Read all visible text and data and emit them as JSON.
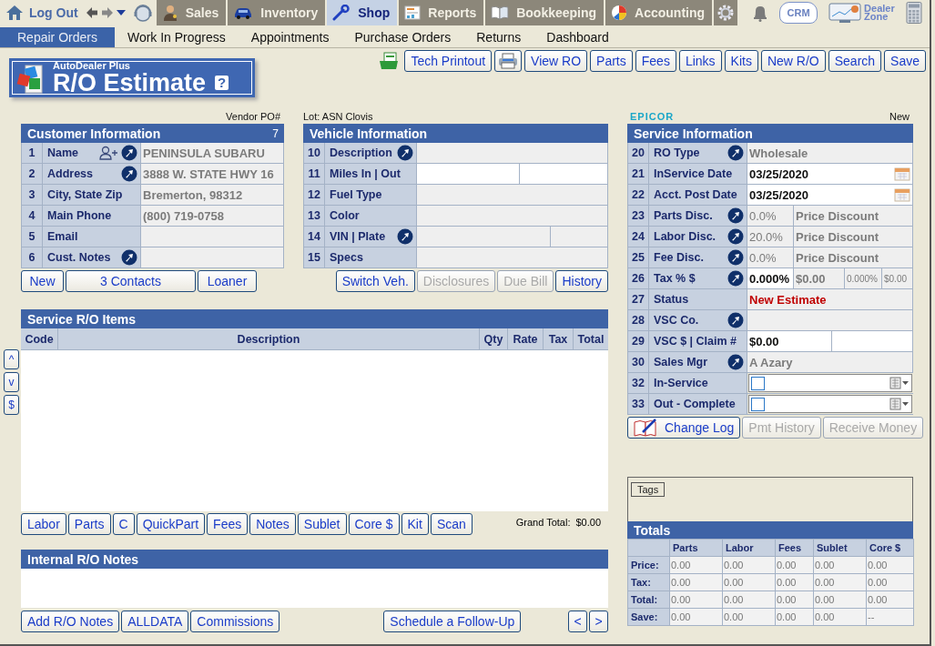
{
  "top_bar": {
    "logout": "Log Out",
    "modules": [
      {
        "label": "Sales",
        "selected": false
      },
      {
        "label": "Inventory",
        "selected": false
      },
      {
        "label": "Shop",
        "selected": true
      },
      {
        "label": "Reports",
        "selected": false
      },
      {
        "label": "Bookkeeping",
        "selected": false
      },
      {
        "label": "Accounting",
        "selected": false
      }
    ],
    "crm": "CRM",
    "dealer_zone": "Dealer Zone"
  },
  "menu": [
    {
      "label": "Repair Orders",
      "selected": true
    },
    {
      "label": "Work In Progress",
      "selected": false
    },
    {
      "label": "Appointments",
      "selected": false
    },
    {
      "label": "Purchase Orders",
      "selected": false
    },
    {
      "label": "Returns",
      "selected": false
    },
    {
      "label": "Dashboard",
      "selected": false
    }
  ],
  "logo": {
    "brand": "AutoDealer Plus",
    "title": "R/O Estimate",
    "help": "?"
  },
  "toolbar": [
    {
      "kind": "export"
    },
    {
      "kind": "text",
      "label": "Tech Printout"
    },
    {
      "kind": "print"
    },
    {
      "kind": "text",
      "label": "View RO"
    },
    {
      "kind": "text",
      "label": "Parts"
    },
    {
      "kind": "text",
      "label": "Fees"
    },
    {
      "kind": "text",
      "label": "Links"
    },
    {
      "kind": "text",
      "label": "Kits"
    },
    {
      "kind": "text",
      "label": "New R/O"
    },
    {
      "kind": "text",
      "label": "Search"
    },
    {
      "kind": "text",
      "label": "Save"
    }
  ],
  "customer": {
    "note": "Vendor PO#",
    "title": "Customer Information",
    "count": "7",
    "rows": [
      {
        "number": "1",
        "label": "Name",
        "add_contact": true,
        "lookup": true,
        "kind": "text",
        "cells": [
          {
            "value": "PENINSULA SUBARU",
            "editable": false
          }
        ]
      },
      {
        "number": "2",
        "label": "Address",
        "add_contact": false,
        "lookup": true,
        "kind": "text",
        "cells": [
          {
            "value": "3888 W. STATE HWY 16",
            "editable": false
          }
        ]
      },
      {
        "number": "3",
        "label": "City, State Zip",
        "add_contact": false,
        "lookup": false,
        "kind": "text",
        "cells": [
          {
            "value": "Bremerton,  98312",
            "editable": false
          }
        ]
      },
      {
        "number": "4",
        "label": "Main Phone",
        "add_contact": false,
        "lookup": false,
        "kind": "text",
        "cells": [
          {
            "value": "(800) 719-0758",
            "editable": false
          }
        ]
      },
      {
        "number": "5",
        "label": "Email",
        "add_contact": false,
        "lookup": false,
        "kind": "text",
        "cells": [
          {
            "editable": false
          }
        ]
      },
      {
        "number": "6",
        "label": "Cust. Notes",
        "add_contact": false,
        "lookup": true,
        "kind": "text",
        "cells": [
          {
            "editable": false
          }
        ]
      }
    ],
    "buttons": [
      {
        "label": "New",
        "disabled": false
      },
      {
        "label": "3 Contacts",
        "disabled": false
      },
      {
        "label": "Loaner",
        "disabled": false
      }
    ]
  },
  "vehicle": {
    "note": "Lot: ASN Clovis",
    "title": "Vehicle Information",
    "rows": [
      {
        "number": "10",
        "label": "Description",
        "add_contact": false,
        "lookup": true,
        "kind": "text",
        "cells": [
          {
            "editable": false
          }
        ]
      },
      {
        "number": "11",
        "label": "Miles  In | Out",
        "add_contact": false,
        "lookup": false,
        "kind": "miles",
        "cells": [
          {
            "editable": true
          },
          {
            "editable": true
          }
        ]
      },
      {
        "number": "12",
        "label": "Fuel Type",
        "add_contact": false,
        "lookup": false,
        "kind": "text",
        "cells": [
          {
            "editable": false
          }
        ]
      },
      {
        "number": "13",
        "label": "Color",
        "add_contact": false,
        "lookup": false,
        "kind": "text",
        "cells": [
          {
            "editable": false
          }
        ]
      },
      {
        "number": "14",
        "label": "VIN | Plate",
        "add_contact": false,
        "lookup": true,
        "kind": "vin",
        "cells": [
          {
            "editable": false
          },
          {
            "editable": false
          }
        ]
      },
      {
        "number": "15",
        "label": "Specs",
        "add_contact": false,
        "lookup": false,
        "kind": "text",
        "cells": [
          {
            "editable": false
          }
        ]
      }
    ],
    "buttons": [
      {
        "label": "Switch Veh.",
        "disabled": false
      },
      {
        "label": "Disclosures",
        "disabled": true
      },
      {
        "label": "Due Bill",
        "disabled": true
      },
      {
        "label": "History",
        "disabled": false
      }
    ]
  },
  "service": {
    "logo": "EPICOR",
    "note": "New",
    "title": "Service Information",
    "rows": [
      {
        "number": "20",
        "label": "RO Type",
        "add_contact": false,
        "lookup": true,
        "kind": "text",
        "cells": [
          {
            "value": "Wholesale",
            "editable": false
          }
        ]
      },
      {
        "number": "21",
        "label": "InService Date",
        "add_contact": false,
        "lookup": false,
        "kind": "date",
        "cells": [
          {
            "value": "03/25/2020",
            "editable": true
          }
        ]
      },
      {
        "number": "22",
        "label": "Acct. Post Date",
        "add_contact": false,
        "lookup": false,
        "kind": "date",
        "cells": [
          {
            "value": "03/25/2020",
            "editable": true
          }
        ]
      },
      {
        "number": "23",
        "label": "Parts Disc.",
        "add_contact": false,
        "lookup": true,
        "kind": "discount",
        "cells": [
          {
            "value": "0.0%",
            "editable": false
          },
          {
            "value": "Price Discount",
            "editable": false
          }
        ]
      },
      {
        "number": "24",
        "label": "Labor Disc.",
        "add_contact": false,
        "lookup": true,
        "kind": "discount",
        "cells": [
          {
            "value": "20.0%",
            "editable": false
          },
          {
            "value": "Price Discount",
            "editable": false
          }
        ]
      },
      {
        "number": "25",
        "label": "Fee Disc.",
        "add_contact": false,
        "lookup": true,
        "kind": "discount",
        "cells": [
          {
            "value": "0.0%",
            "editable": false
          },
          {
            "value": "Price Discount",
            "editable": false
          }
        ]
      },
      {
        "number": "26",
        "label": "Tax % $",
        "add_contact": false,
        "lookup": true,
        "kind": "tax",
        "cells": [
          {
            "value": "0.000%",
            "editable": true
          },
          {
            "value": "$0.00",
            "editable": false
          },
          {
            "value": "0.000%",
            "editable": false
          },
          {
            "value": "$0.00",
            "editable": false
          }
        ]
      },
      {
        "number": "27",
        "label": "Status",
        "add_contact": false,
        "lookup": false,
        "kind": "status",
        "cells": [
          {
            "value": "New Estimate",
            "editable": false
          }
        ]
      },
      {
        "number": "28",
        "label": "VSC  Co.",
        "add_contact": false,
        "lookup": true,
        "kind": "text",
        "cells": [
          {
            "editable": false
          }
        ]
      },
      {
        "number": "29",
        "label": "VSC $ | Claim #",
        "add_contact": false,
        "lookup": false,
        "kind": "vsc",
        "cells": [
          {
            "value": "$0.00",
            "editable": true
          },
          {
            "editable": true
          }
        ]
      },
      {
        "number": "30",
        "label": "Sales Mgr",
        "add_contact": false,
        "lookup": true,
        "kind": "text",
        "cells": [
          {
            "value": "A Azary",
            "editable": false
          }
        ]
      },
      {
        "number": "32",
        "label": "In-Service",
        "add_contact": false,
        "lookup": false,
        "kind": "check",
        "cells": [
          {
            "checked": false,
            "editable": true
          }
        ]
      },
      {
        "number": "33",
        "label": "Out - Complete",
        "add_contact": false,
        "lookup": false,
        "kind": "check",
        "cells": [
          {
            "checked": false,
            "editable": true
          }
        ]
      }
    ],
    "buttons": [
      {
        "label": "Change Log",
        "disabled": false,
        "kind": "log"
      },
      {
        "label": "Pmt History",
        "disabled": true,
        "kind": "text"
      },
      {
        "label": "Receive Money",
        "disabled": true,
        "kind": "text"
      }
    ]
  },
  "side_buttons": [
    "^",
    "v",
    "$"
  ],
  "items": {
    "title": "Service R/O Items",
    "columns": [
      "Code",
      "Description",
      "Qty",
      "Rate",
      "Tax",
      "Total"
    ],
    "buttons": [
      "Labor",
      "Parts",
      "C",
      "QuickPart",
      "Fees",
      "Notes",
      "Sublet",
      "Core $",
      "Kit",
      "Scan"
    ],
    "grand_total_label": "Grand Total:",
    "grand_total": "$0.00"
  },
  "notes": {
    "title": "Internal R/O Notes",
    "buttons": [
      "Add R/O Notes",
      "ALLDATA",
      "Commissions"
    ],
    "follow_up": "Schedule a Follow-Up",
    "pager": [
      "<",
      ">"
    ]
  },
  "tags": {
    "label": "Tags"
  },
  "totals": {
    "title": "Totals",
    "columns": [
      "Parts",
      "Labor",
      "Fees",
      "Sublet",
      "Core $"
    ],
    "rows": [
      {
        "label": "Price:",
        "values": [
          "0.00",
          "0.00",
          "0.00",
          "0.00",
          "0.00"
        ]
      },
      {
        "label": "Tax:",
        "values": [
          "0.00",
          "0.00",
          "0.00",
          "0.00",
          "0.00"
        ]
      },
      {
        "label": "Total:",
        "values": [
          "0.00",
          "0.00",
          "0.00",
          "0.00",
          "0.00"
        ]
      },
      {
        "label": "Save:",
        "values": [
          "0.00",
          "0.00",
          "0.00",
          "0.00",
          "--"
        ]
      }
    ]
  }
}
